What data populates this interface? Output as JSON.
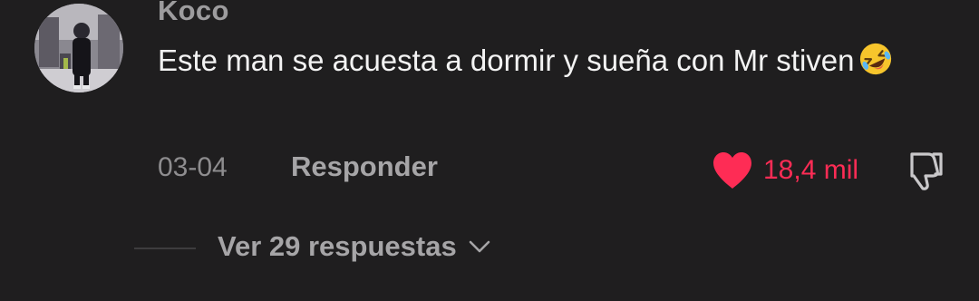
{
  "comment": {
    "username": "Koco",
    "text": "Este man se acuesta a dormir y sueña con Mr stiven",
    "emoji": "rolling-on-the-floor-laughing-emoji",
    "date": "03-04",
    "reply_label": "Responder",
    "likes": "18,4 mil",
    "liked": true,
    "view_replies_label": "Ver 29 respuestas"
  },
  "icons": {
    "like": "heart-icon",
    "dislike": "thumbs-down-icon",
    "expand": "chevron-down-icon"
  },
  "colors": {
    "background": "#1f1e1f",
    "accent_like": "#fe2c55",
    "username": "#9d9c9e",
    "text": "#f3f3f3",
    "muted": "#a6a5a7"
  }
}
